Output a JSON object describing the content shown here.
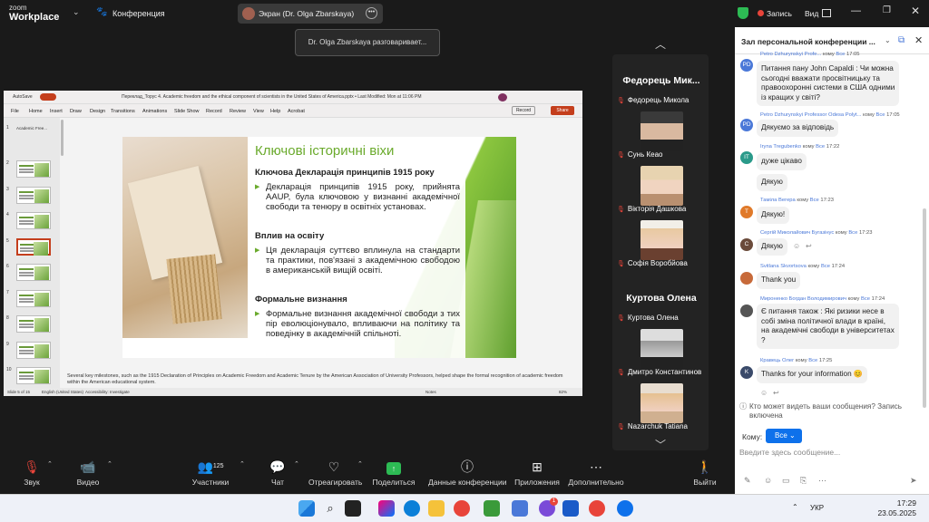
{
  "app": {
    "brand_top": "zoom",
    "brand_bottom": "Workplace",
    "meeting_label": "Конференция"
  },
  "share": {
    "label": "Экран (Dr. Olga Zbarskaya)",
    "speaking": "Dr. Olga Zbarskaya разговаривает..."
  },
  "topright": {
    "record": "Запись",
    "view": "Вид"
  },
  "ppt": {
    "autosave": "AutoSave",
    "filename": "Переклад_Торус 4. Academic freedom and the ethical component of scientists in the United States of America.pptx • Last Modified: Mon at 11:06 PM",
    "menu": [
      "File",
      "Home",
      "Insert",
      "Draw",
      "Design",
      "Transitions",
      "Animations",
      "Slide Show",
      "Record",
      "Review",
      "View",
      "Help",
      "Acrobat"
    ],
    "record_btn": "Record",
    "share_btn": "Share",
    "thumb_numbers": [
      "1",
      "2",
      "3",
      "4",
      "5",
      "6",
      "7",
      "8",
      "9",
      "10"
    ],
    "thumb_first_title": "Academic Free...",
    "slide": {
      "title": "Ключові історичні віхи",
      "h1": "Ключова Декларація принципів 1915 року",
      "b1": "Декларація принципів 1915 року, прийнята AAUP, була ключовою у визнанні академічної свободи та тенюру в освітніх установах.",
      "h2": "Вплив на освіту",
      "b2": "Ця декларація суттєво вплинула на стандарти та практики, пов'язані з академічною свободою в американській вищій освіті.",
      "h3": "Формальне визнання",
      "b3": "Формальне визнання академічної свободи з тих пір еволюціонувало, впливаючи на політику та поведінку в академічній спільноті."
    },
    "notes": "Several key milestones, such as the 1915 Declaration of Principles on Academic Freedom and Academic Tenure by the American Association of University Professors, helped shape the formal recognition of academic freedom within the American educational system.",
    "status": {
      "slide": "Slide 5 of 15",
      "lang": "English (United States)",
      "access": "Accessibility: Investigate",
      "notes": "Notes",
      "zoom": "82%"
    }
  },
  "gallery": {
    "tile1_name": "Федорець Мик...",
    "tile2_name": "Куртова Олена",
    "participants": [
      "Федорець Микола",
      "Сунь Кеао",
      "Вікторія Дашкова",
      "Софія Воробйова",
      "Куртова Олена",
      "Дмитро Константинов",
      "Nazarchuk Tatiana"
    ]
  },
  "toolbar": {
    "audio": "Звук",
    "video": "Видео",
    "participants": "Участники",
    "participants_count": "125",
    "chat": "Чат",
    "react": "Отреагировать",
    "share": "Поделиться",
    "info": "Данные конференции",
    "apps": "Приложения",
    "more": "Дополнительно",
    "leave": "Выйти"
  },
  "chat": {
    "title": "Зал персональной конференции ...",
    "to_all": "Все",
    "messages": [
      {
        "sender": "Petro Dzhurynskyi Profe...",
        "to": "Все",
        "time": "17:05",
        "initials": "PD",
        "color": "#4a78d8",
        "lines": [
          "Питання пану John Capaldi : Чи можна",
          "сьогодні вважати просвітницьку та",
          "правоохоронні системи в США одними",
          "із кращих у світі?"
        ]
      },
      {
        "sender": "Petro Dzhurynskyi Professor Odesa Polyt...",
        "to": "Все",
        "time": "17:05",
        "initials": "PD",
        "color": "#4a78d8",
        "lines": [
          "Дякуємо за відповідь"
        ]
      },
      {
        "sender": "Iryna Tregubenko",
        "to": "Все",
        "time": "17:22",
        "initials": "IT",
        "color": "#2a9a8a",
        "lines": [
          "дуже цікаво"
        ]
      },
      {
        "sender": "",
        "to": "",
        "time": "",
        "initials": "",
        "color": "",
        "lines": [
          "Дякую"
        ]
      },
      {
        "sender": "Таміла Вегера",
        "to": "Все",
        "time": "17:23",
        "initials": "T",
        "color": "#e07a2a",
        "lines": [
          "Дякую!"
        ]
      },
      {
        "sender": "Сергій Миколайович Бугазінус",
        "to": "Все",
        "time": "17:23",
        "initials": "С",
        "color": "#6a4a3a",
        "lines": [
          "Дякую"
        ]
      },
      {
        "sender": "Svitlana Skvortsova",
        "to": "Все",
        "time": "17:24",
        "initials": "",
        "color": "#c76a3a",
        "lines": [
          "Thank you"
        ]
      },
      {
        "sender": "Мироненко Богдан Володимирович",
        "to": "Все",
        "time": "17:24",
        "initials": "",
        "color": "#555",
        "lines": [
          "Є питання також : Які ризики несе в",
          "собі зміна політичної влади в країні,",
          "на академічні свободи в університетах",
          "?"
        ]
      },
      {
        "sender": "Кравець Олег",
        "to": "Все",
        "time": "17:25",
        "initials": "K",
        "color": "#3a4a6a",
        "lines": [
          "Thanks for your information 😊"
        ]
      }
    ],
    "to_label": "кому",
    "visibility": "Кто может видеть ваши сообщения? Запись включена",
    "recipient_label": "Кому:",
    "recipient": "Все",
    "input_placeholder": "Введите здесь сообщение..."
  },
  "taskbar": {
    "lang": "УКР",
    "time": "17:29",
    "date": "23.05.2025",
    "chat_badge": "1"
  }
}
